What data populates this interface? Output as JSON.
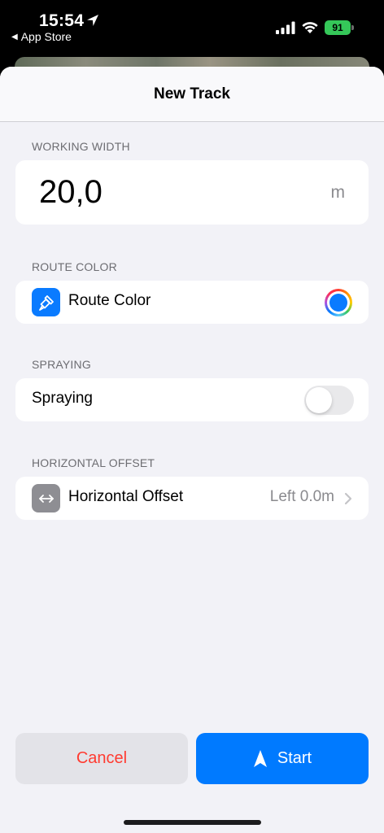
{
  "status_bar": {
    "time": "15:54",
    "back_label": "App Store",
    "battery": "91",
    "icons": [
      "location-arrow-icon",
      "signal-icon",
      "wifi-icon",
      "battery-icon"
    ]
  },
  "nav": {
    "title": "New Track"
  },
  "working_width": {
    "header": "WORKING WIDTH",
    "value": "20,0",
    "unit": "m"
  },
  "route_color": {
    "header": "ROUTE COLOR",
    "label": "Route Color",
    "icon": "paintbrush-icon",
    "icon_bg": "#0a7bff",
    "selected_color": "#0a7bff"
  },
  "spraying": {
    "header": "SPRAYING",
    "label": "Spraying",
    "enabled": false
  },
  "horizontal_offset": {
    "header": "HORIZONTAL OFFSET",
    "label": "Horizontal Offset",
    "icon": "left-right-arrows-icon",
    "icon_bg": "#8e8e93",
    "value": "Left 0.0m"
  },
  "actions": {
    "cancel_label": "Cancel",
    "start_label": "Start",
    "cancel_color": "#ff3b30",
    "start_bg": "#007aff"
  }
}
